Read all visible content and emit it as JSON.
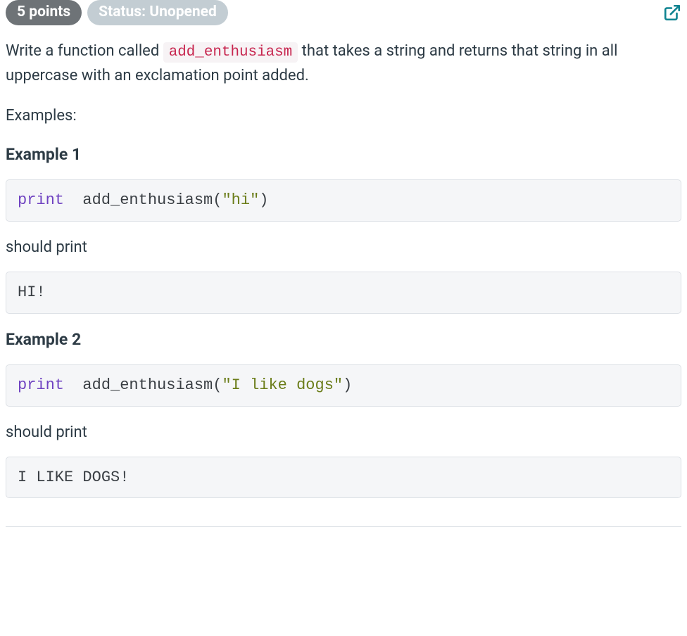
{
  "header": {
    "points_label": "5 points",
    "status_label": "Status: Unopened"
  },
  "description": {
    "pre_text": "Write a function called ",
    "code": "add_enthusiasm",
    "post_text": " that takes a string and returns that string in all uppercase with an exclamation point added."
  },
  "examples_label": "Examples:",
  "examples": [
    {
      "heading": "Example 1",
      "code": {
        "keyword": "print",
        "space": "  ",
        "func": "add_enthusiasm",
        "open": "(",
        "string": "\"hi\"",
        "close": ")"
      },
      "should_print_label": "should print",
      "output": "HI!"
    },
    {
      "heading": "Example 2",
      "code": {
        "keyword": "print",
        "space": "  ",
        "func": "add_enthusiasm",
        "open": "(",
        "string": "\"I like dogs\"",
        "close": ")"
      },
      "should_print_label": "should print",
      "output": "I LIKE DOGS!"
    }
  ]
}
